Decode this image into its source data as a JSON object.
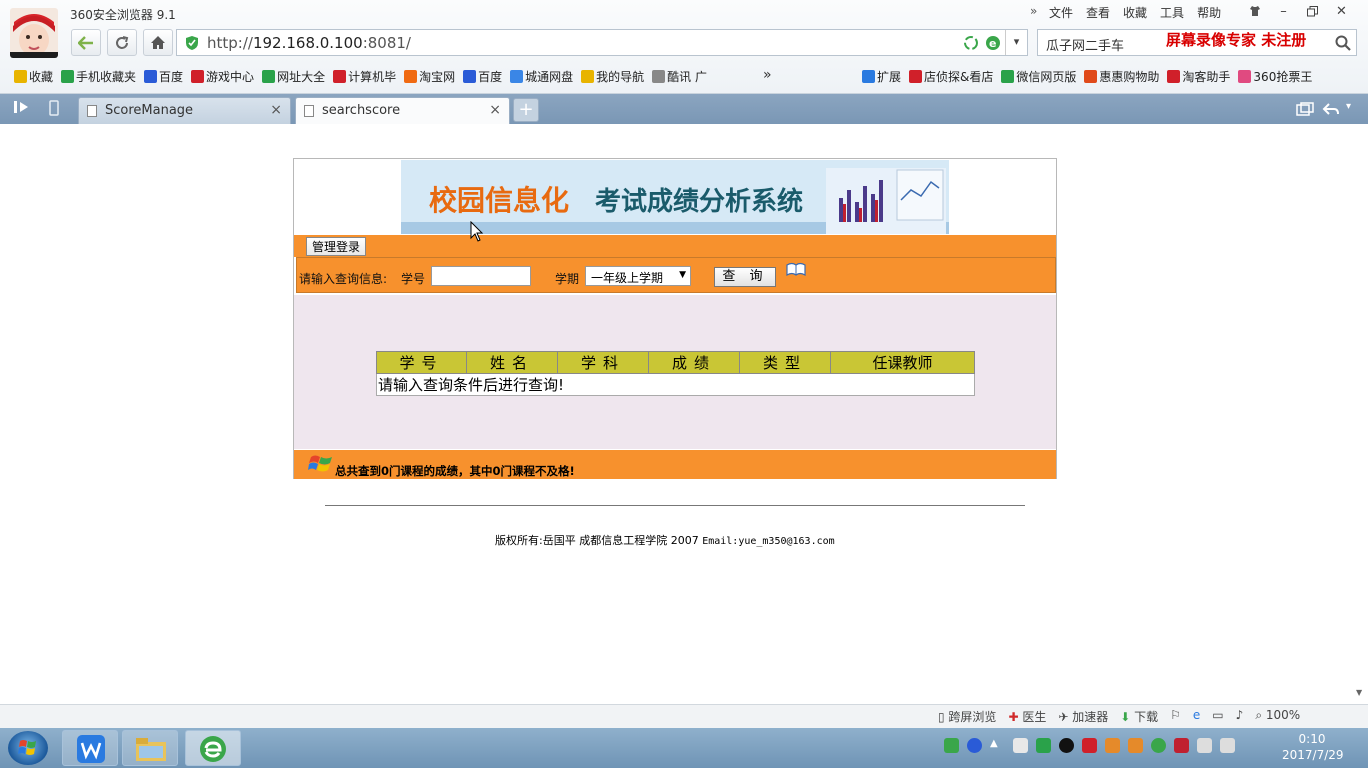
{
  "browser": {
    "title": "360安全浏览器 9.1",
    "menu": [
      "文件",
      "查看",
      "收藏",
      "工具",
      "帮助"
    ],
    "window_controls": [
      "shirt-icon",
      "minimize-icon",
      "restore-icon",
      "close-icon"
    ],
    "url": {
      "prefix": "http://",
      "host": "192.168.0.100",
      "port": ":8081/"
    },
    "search": "瓜子网二手车",
    "watermark": "屏幕录像专家  未注册",
    "bookmarks": [
      {
        "label": "收藏",
        "color": "#e8b400"
      },
      {
        "label": "手机收藏夹",
        "color": "#2aa24a"
      },
      {
        "label": "百度",
        "color": "#2a5bd7"
      },
      {
        "label": "游戏中心",
        "color": "#d0202a"
      },
      {
        "label": "网址大全",
        "color": "#2aa24a"
      },
      {
        "label": "计算机毕",
        "color": "#d0202a"
      },
      {
        "label": "淘宝网",
        "color": "#f06a12"
      },
      {
        "label": "百度",
        "color": "#2a5bd7"
      },
      {
        "label": "城通网盘",
        "color": "#3a86e6"
      },
      {
        "label": "我的导航",
        "color": "#e8b400"
      },
      {
        "label": "酷讯 广",
        "color": "#888888"
      }
    ],
    "bookmarks_more": "»",
    "extensions": [
      {
        "label": "扩展",
        "color": "#2a7ae0"
      },
      {
        "label": "店侦探&看店",
        "color": "#d0202a"
      },
      {
        "label": "微信网页版",
        "color": "#2aa24a"
      },
      {
        "label": "惠惠购物助",
        "color": "#e04a1a"
      },
      {
        "label": "淘客助手",
        "color": "#d0202a"
      },
      {
        "label": "360抢票王",
        "color": "#e04a80"
      }
    ],
    "tabs": [
      {
        "label": "ScoreManage",
        "close": "×"
      },
      {
        "label": "searchscore",
        "close": "×"
      }
    ],
    "new_tab": "+",
    "status_items": [
      "跨屏浏览",
      "医生",
      "加速器",
      "下载",
      "100%"
    ]
  },
  "page": {
    "login_button": "管理登录",
    "query_prompt": "请输入查询信息:",
    "student_id_label": "学号",
    "student_id_value": "",
    "term_label": "学期",
    "term_selected": "一年级上学期",
    "query_button": "查 询",
    "table_headers": [
      "学号",
      "姓名",
      "学科",
      "成绩",
      "类型",
      "任课教师"
    ],
    "table_message": "请输入查询条件后进行查询!",
    "summary": {
      "prefix": "总共查到",
      "total": "0",
      "middle": "门课程的成绩，其中",
      "failed": "0",
      "suffix": "门课程不及格!"
    },
    "copyright": "版权所有:岳国平 成都信息工程学院 2007",
    "email": "Email:yue_m350@163.com"
  },
  "taskbar": {
    "clock_time": "0:10",
    "clock_date": "2017/7/29"
  }
}
